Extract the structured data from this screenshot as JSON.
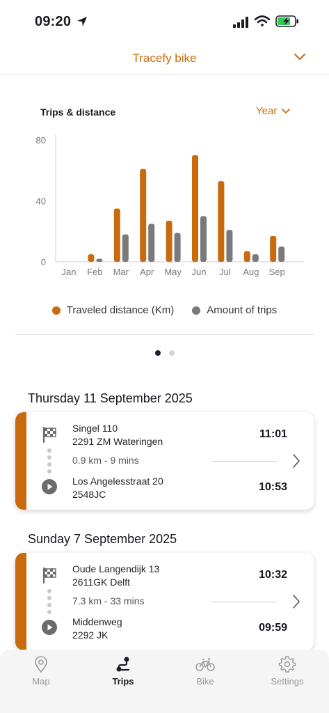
{
  "status_bar": {
    "time": "09:20"
  },
  "header": {
    "title": "Tracefy bike"
  },
  "chart_section": {
    "title": "Trips & distance",
    "period": "Year"
  },
  "colors": {
    "accent": "#c96a0c",
    "secondary": "#7a7a7a",
    "dark": "#1b1b24"
  },
  "chart_data": {
    "type": "bar",
    "categories": [
      "Jan",
      "Feb",
      "Mar",
      "Apr",
      "May",
      "Jun",
      "Jul",
      "Aug",
      "Sep"
    ],
    "series": [
      {
        "name": "Traveled distance (Km)",
        "color": "#c96a0c",
        "values": [
          0,
          5,
          35,
          61,
          27,
          70,
          53,
          7,
          17
        ]
      },
      {
        "name": "Amount of trips",
        "color": "#7a7a7a",
        "values": [
          0,
          2,
          18,
          25,
          19,
          30,
          21,
          5,
          10
        ]
      }
    ],
    "y_ticks": [
      "0",
      "40",
      "80"
    ],
    "ylim": [
      0,
      80
    ],
    "legend": "bottom",
    "grid": false
  },
  "pager": {
    "pages": 2,
    "current": 0
  },
  "trip_groups": [
    {
      "date": "Thursday 11 September 2025",
      "trip": {
        "end_address_line1": "Singel 110",
        "end_address_line2": "2291 ZM Wateringen",
        "end_time": "11:01",
        "summary": "0.9 km - 9 mins",
        "start_address_line1": "Los Angelesstraat 20",
        "start_address_line2": "2548JC",
        "start_time": "10:53"
      }
    },
    {
      "date": "Sunday 7 September 2025",
      "trip": {
        "end_address_line1": "Oude Langendijk 13",
        "end_address_line2": "2611GK Delft",
        "end_time": "10:32",
        "summary": "7.3 km - 33 mins",
        "start_address_line1": "Middenweg",
        "start_address_line2": "2292 JK",
        "start_time": "09:59"
      }
    }
  ],
  "tab_bar": {
    "items": [
      {
        "label": "Map",
        "icon": "map-pin-icon",
        "active": false
      },
      {
        "label": "Trips",
        "icon": "route-icon",
        "active": true
      },
      {
        "label": "Bike",
        "icon": "bicycle-icon",
        "active": false
      },
      {
        "label": "Settings",
        "icon": "gear-icon",
        "active": false
      }
    ]
  }
}
